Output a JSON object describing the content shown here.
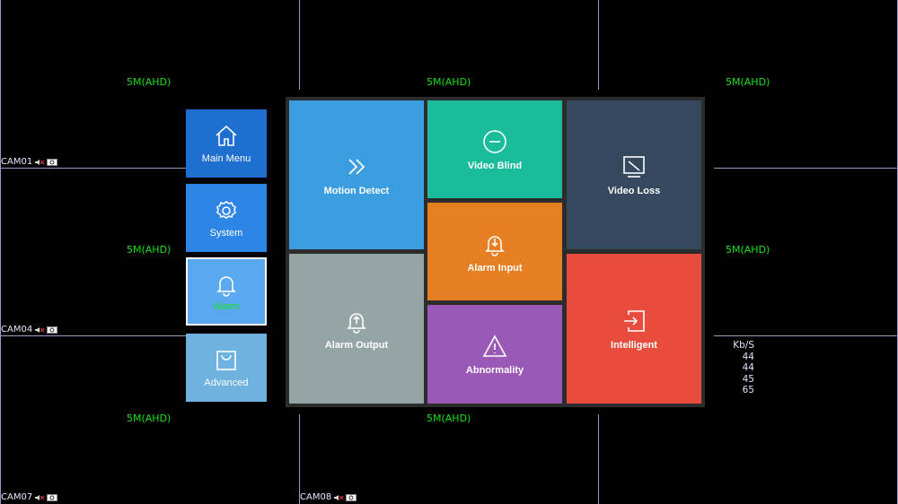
{
  "grid": {
    "resolution_labels": [
      "5M(AHD)",
      "5M(AHD)",
      "5M(AHD)",
      "5M(AHD)",
      "5M(AHD)",
      "5M(AHD)",
      "5M(AHD)"
    ],
    "cameras": [
      "CAM01",
      "CAM04",
      "CAM07",
      "CAM08"
    ]
  },
  "bitrate": {
    "header": "Kb/S",
    "values": [
      "44",
      "44",
      "45",
      "65"
    ]
  },
  "sidebar": {
    "items": [
      {
        "label": "Main Menu",
        "icon": "home-icon"
      },
      {
        "label": "System",
        "icon": "gear-icon"
      },
      {
        "label": "Alarm",
        "icon": "bell-icon",
        "active": true
      },
      {
        "label": "Advanced",
        "icon": "bag-icon"
      }
    ],
    "active_label_color": "#19e019"
  },
  "tiles": [
    {
      "label": "Motion Detect",
      "icon": "chevrons-right-icon",
      "color": "#3a9de0"
    },
    {
      "label": "Video Blind",
      "icon": "minus-circle-icon",
      "color": "#1abc9c"
    },
    {
      "label": "Video Loss",
      "icon": "no-signal-icon",
      "color": "#34495e"
    },
    {
      "label": "Alarm Input",
      "icon": "bell-down-icon",
      "color": "#e67e22"
    },
    {
      "label": "Alarm Output",
      "icon": "bell-up-icon",
      "color": "#95a5a6"
    },
    {
      "label": "Abnormality",
      "icon": "warning-icon",
      "color": "#9b59b6"
    },
    {
      "label": "Intelligent",
      "icon": "enter-box-icon",
      "color": "#e74c3c"
    }
  ]
}
